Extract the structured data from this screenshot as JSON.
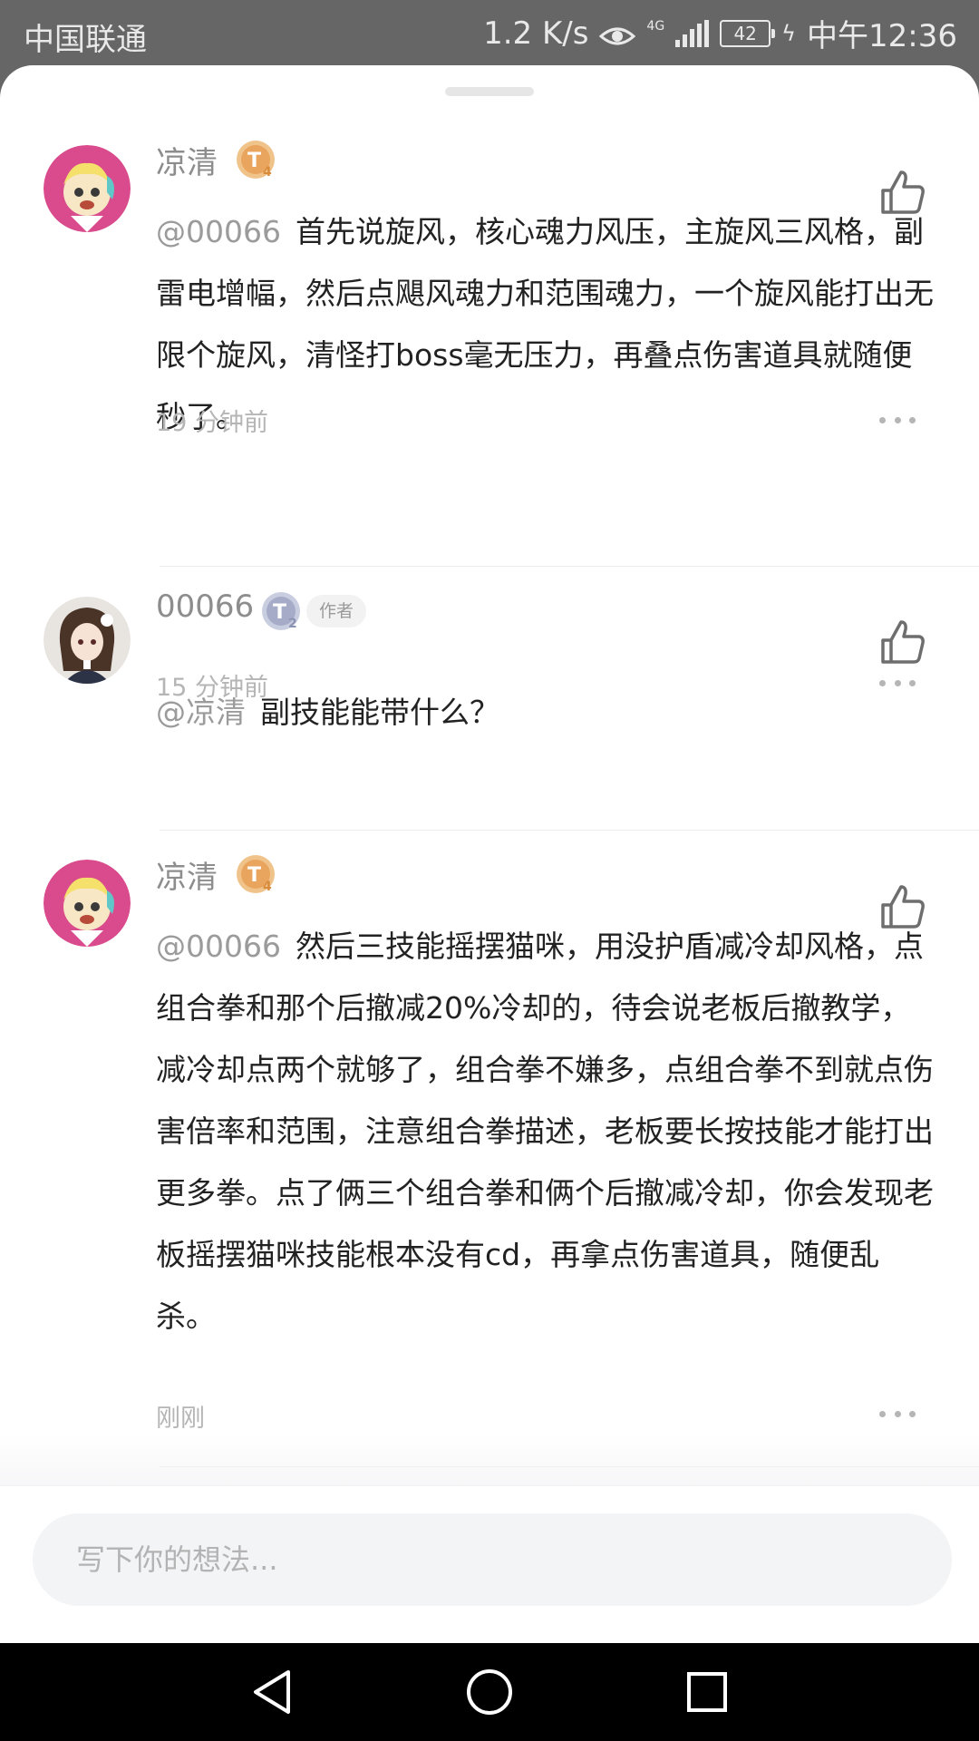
{
  "status_bar": {
    "carrier": "中国联通",
    "speed": "1.2 K/s",
    "network": "4G",
    "battery": "42",
    "time": "中午12:36"
  },
  "comments": [
    {
      "user": "凉清",
      "level_badge": "T4",
      "mention": "@00066",
      "text": "首先说旋风，核心魂力风压，主旋风三风格，副雷电增幅，然后点飓风魂力和范围魂力，一个旋风能打出无限个旋风，清怪打boss毫无压力，再叠点伤害道具就随便秒了。",
      "time": "19 分钟前"
    },
    {
      "user": "00066",
      "level_badge": "T2",
      "author_tag": "作者",
      "mention": "@凉清",
      "text": "副技能能带什么？",
      "time": "15 分钟前"
    },
    {
      "user": "凉清",
      "level_badge": "T4",
      "mention": "@00066",
      "text": "然后三技能摇摆猫咪，用没护盾减冷却风格，点组合拳和那个后撤减20%冷却的，待会说老板后撤教学，减冷却点两个就够了，组合拳不嫌多，点组合拳不到就点伤害倍率和范围，注意组合拳描述，老板要长按技能才能打出更多拳。点了俩三个组合拳和俩个后撤减冷却，你会发现老板摇摆猫咪技能根本没有cd，再拿点伤害道具，随便乱杀。",
      "time": "刚刚"
    }
  ],
  "input": {
    "placeholder": "写下你的想法..."
  },
  "icons": {
    "like": "thumbs-up-icon",
    "more": "more-dots-icon",
    "back": "back-triangle-icon",
    "home": "home-circle-icon",
    "recents": "recents-square-icon"
  }
}
